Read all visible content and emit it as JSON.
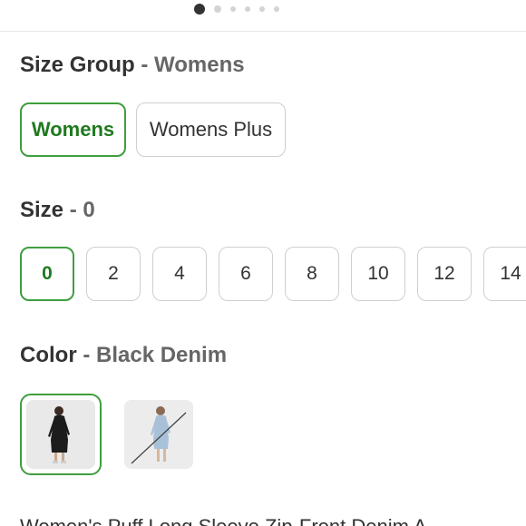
{
  "carousel": {
    "dots": 6,
    "active_index": 0
  },
  "size_group": {
    "label": "Size Group",
    "separator": " - ",
    "selected_value": "Womens",
    "options": [
      "Womens",
      "Womens Plus"
    ]
  },
  "size": {
    "label": "Size",
    "separator": " - ",
    "selected_value": "0",
    "options": [
      "0",
      "2",
      "4",
      "6",
      "8",
      "10",
      "12",
      "14"
    ]
  },
  "color": {
    "label": "Color",
    "separator": " - ",
    "selected_value": "Black Denim",
    "swatches": [
      {
        "name": "Black Denim",
        "selected": true,
        "available": true
      },
      {
        "name": "Light Blue Denim",
        "selected": false,
        "available": false
      }
    ]
  },
  "product": {
    "title": "Women's Puff Long Sleeve Zip-Front Denim A"
  },
  "colors": {
    "accent": "#3e9e3e",
    "accent_text": "#1f7a1f"
  }
}
